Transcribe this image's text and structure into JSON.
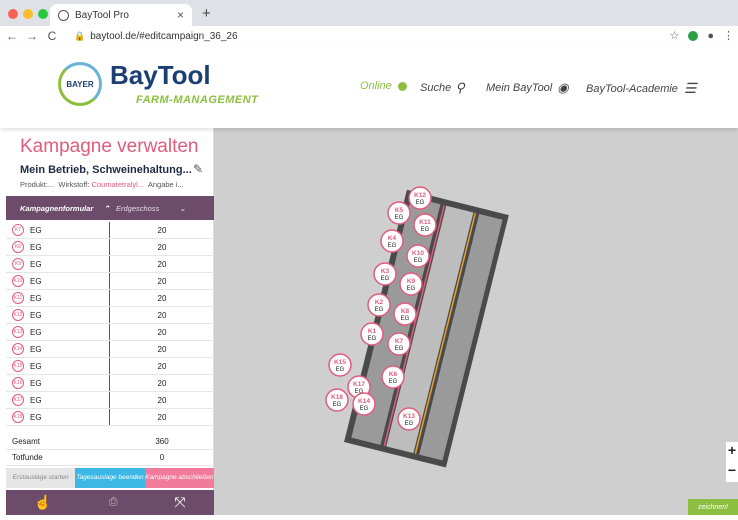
{
  "browser": {
    "tab_title": "BayTool Pro",
    "tab_close": "×",
    "new_tab": "+",
    "url": "baytool.de/#editcampaign_36_26"
  },
  "header": {
    "brand": "BayTool",
    "brand_sub": "FARM-MANAGEMENT",
    "logo_text": "BAYER",
    "online": "Online",
    "suche": "Suche",
    "mein": "Mein BayTool",
    "academie": "BayTool-Academie"
  },
  "panel": {
    "title": "Kampagne verwalten",
    "subtitle": "Mein Betrieb, Schweinehaltung...",
    "produkt": "Produkt:...",
    "wirkstoff_label": "Wirkstoff:",
    "wirkstoff": "Coumatetralyl...",
    "angabe": "Angabe i...",
    "form_tab": "Kampagnenformular",
    "floor": "Erdgeschoss",
    "rows": [
      {
        "badge": "K7",
        "label": "EG",
        "value": "20"
      },
      {
        "badge": "K8",
        "label": "EG",
        "value": "20"
      },
      {
        "badge": "K9",
        "label": "EG",
        "value": "20"
      },
      {
        "badge": "K10",
        "label": "EG",
        "value": "20"
      },
      {
        "badge": "K11",
        "label": "EG",
        "value": "20"
      },
      {
        "badge": "K12",
        "label": "EG",
        "value": "20"
      },
      {
        "badge": "K13",
        "label": "EG",
        "value": "20"
      },
      {
        "badge": "K14",
        "label": "EG",
        "value": "20"
      },
      {
        "badge": "K15",
        "label": "EG",
        "value": "20"
      },
      {
        "badge": "K16",
        "label": "EG",
        "value": "20"
      },
      {
        "badge": "K17",
        "label": "EG",
        "value": "20"
      },
      {
        "badge": "K18",
        "label": "EG",
        "value": "20"
      }
    ],
    "gesamt_label": "Gesamt",
    "gesamt_value": "360",
    "totfunde_label": "Totfunde",
    "totfunde_value": "0",
    "action1": "Erstauslage starten",
    "action2": "Tagesauslage beenden",
    "action3": "Kampagne abschließen"
  },
  "map": {
    "markers": [
      "K12",
      "K5",
      "K11",
      "K4",
      "K10",
      "K3",
      "K9",
      "K2",
      "K8",
      "K1",
      "K7",
      "K15",
      "K6",
      "K17",
      "K18",
      "K14",
      "K13"
    ],
    "marker_sub": "EG",
    "zeichnen": "zeichnen!"
  },
  "colors": {
    "accent": "#e05c7d",
    "purple": "#6d4c6b",
    "green": "#8cbf3f",
    "blue": "#3db8e6"
  }
}
